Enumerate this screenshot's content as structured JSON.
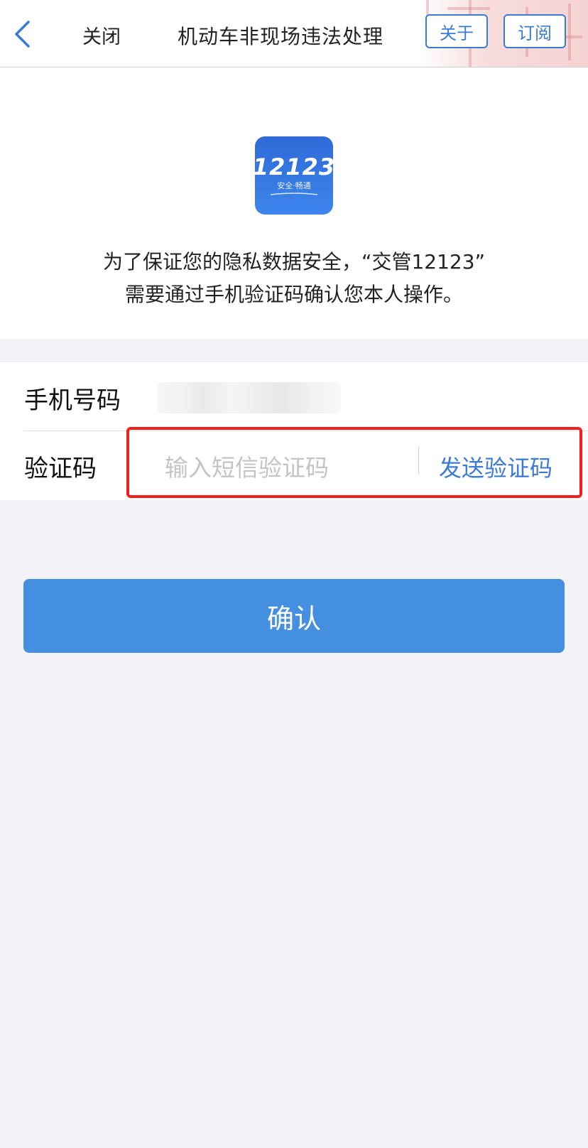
{
  "navbar": {
    "close_label": "关闭",
    "title": "机动车非现场违法处理",
    "about_label": "关于",
    "subscribe_label": "订阅"
  },
  "app_logo": {
    "number": "12123",
    "slogan": "安全·畅通"
  },
  "description": {
    "line1": "为了保证您的隐私数据安全，“交管12123”",
    "line2": "需要通过手机验证码确认您本人操作。"
  },
  "form": {
    "phone_label": "手机号码",
    "code_label": "验证码",
    "code_placeholder": "输入短信验证码",
    "send_code_label": "发送验证码"
  },
  "confirm_label": "确认",
  "colors": {
    "accent": "#3a7bd5",
    "confirm_button": "#458fe1",
    "highlight_border": "#f21f1f",
    "background": "#f2f2f7"
  }
}
